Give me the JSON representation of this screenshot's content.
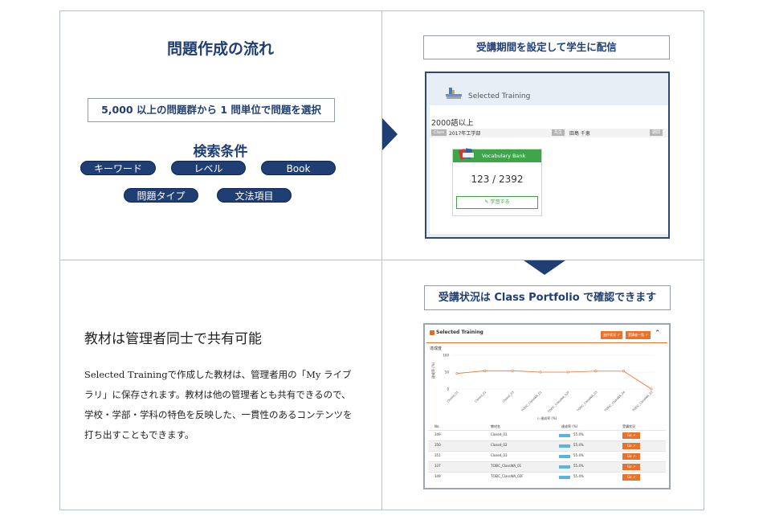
{
  "q1": {
    "title": "問題作成の流れ",
    "box": "5,000 以上の問題群から 1 問単位で問題を選択",
    "search_title": "検索条件",
    "pills": [
      "キーワード",
      "レベル",
      "Book",
      "問題タイプ",
      "文法項目"
    ]
  },
  "q2": {
    "box": "受講期間を設定して学生に配信",
    "screen": {
      "app_title": "Selected Training",
      "subtitle": "2000語以上",
      "class_tag": "Class",
      "class_value": "2017年工学部",
      "teacher_tag": "先生",
      "teacher_value": "田島 千恵",
      "misc_tag": "期間",
      "card_title": "Vocabulary Bank",
      "card_count": "123 / 2392",
      "card_button": "✎ 学習する"
    }
  },
  "q3": {
    "title": "教材は管理者同士で共有可能",
    "body": "Selected Trainingで作成した教材は、管理者用の「My ライブラリ」に保存されます。教材は他の管理者とも共有できるので、学校・学部・学科の特色を反映した、一貫性のあるコンテンツを打ち出すこともできます。"
  },
  "q4": {
    "box": "受講状況は Class Portfolio で確認できます",
    "screen": {
      "app_title": "Selected Training",
      "btn1": "進捗状況 ↗",
      "btn2": "受講者一覧 ↗",
      "section_label": "達成度",
      "legend": "◇ 達成率 (%)",
      "y_label": "達成率 (%)",
      "headers": [
        "No.",
        "教材名",
        "達成率 (%)",
        "受講状況"
      ],
      "rows": [
        {
          "no": "349",
          "name": "Closed_01",
          "rate": "55.4%",
          "go": "Go ↗"
        },
        {
          "no": "350",
          "name": "Closed_02",
          "rate": "55.4%",
          "go": "Go ↗"
        },
        {
          "no": "351",
          "name": "Closed_03",
          "rate": "55.4%",
          "go": "Go ↗"
        },
        {
          "no": "337",
          "name": "TOEIC_ClassWA_01",
          "rate": "55.4%",
          "go": "Go ↗"
        },
        {
          "no": "349",
          "name": "TOEIC_ClassWA_02F",
          "rate": "55.4%",
          "go": "Go ↗"
        }
      ]
    }
  },
  "chart_data": {
    "type": "line",
    "categories": [
      "Closed_01",
      "Closed_02",
      "Closed_03",
      "TOEIC_ClassWA_01",
      "TOEIC_ClassWA_02F",
      "TOEIC_ClassWA_03",
      "TOEIC_ClassWA_04",
      "TOEIC_ClassWA_05"
    ],
    "series": [
      {
        "name": "達成率 (%)",
        "values": [
          46,
          54,
          54,
          50,
          50,
          53,
          53,
          0
        ]
      }
    ],
    "ylabel": "達成率 (%)",
    "yticks": [
      "100",
      "50",
      "0"
    ],
    "ylim": [
      0,
      100
    ],
    "legend": "bottom",
    "color": "#e7732d"
  }
}
